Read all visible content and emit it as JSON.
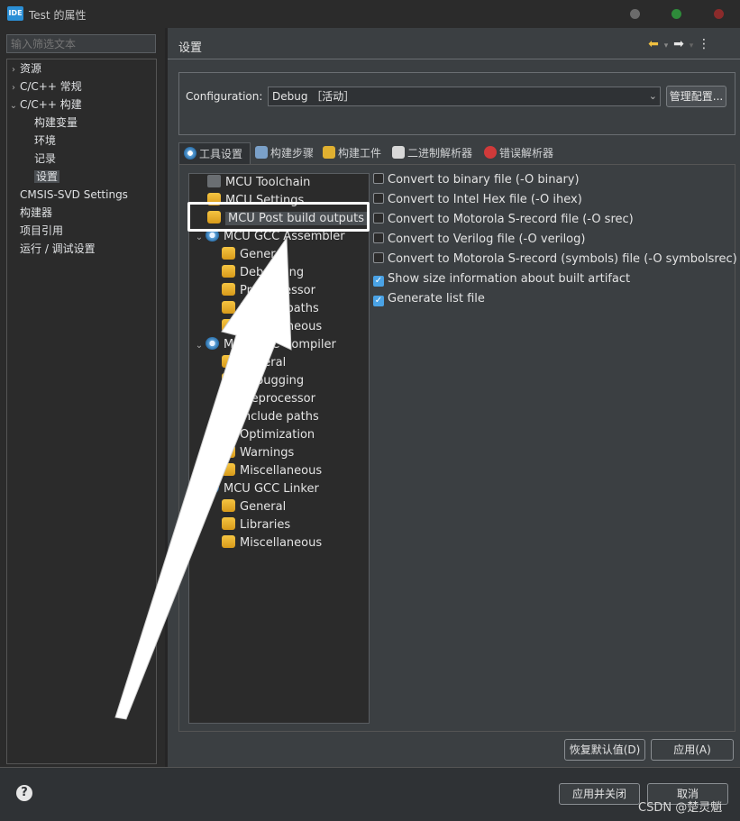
{
  "window": {
    "app_icon_text": "IDE",
    "title": "Test 的属性"
  },
  "sidebar": {
    "filter_placeholder": "输入筛选文本",
    "items": [
      {
        "label": "资源",
        "arrow": "›"
      },
      {
        "label": "C/C++ 常规",
        "arrow": "›"
      },
      {
        "label": "C/C++ 构建",
        "arrow": "⌄"
      },
      {
        "label": "构建变量"
      },
      {
        "label": "环境"
      },
      {
        "label": "记录"
      },
      {
        "label": "设置"
      },
      {
        "label": "CMSIS-SVD Settings"
      },
      {
        "label": "构建器"
      },
      {
        "label": "项目引用"
      },
      {
        "label": "运行 / 调试设置"
      }
    ]
  },
  "header": {
    "section_title": "设置"
  },
  "configuration": {
    "label": "Configuration:",
    "value": "Debug ［活动］",
    "manage_button": "管理配置..."
  },
  "tabs": [
    {
      "label": "工具设置",
      "active": true
    },
    {
      "label": "构建步骤"
    },
    {
      "label": "构建工件"
    },
    {
      "label": "二进制解析器"
    },
    {
      "label": "错误解析器"
    }
  ],
  "tool_tree": [
    {
      "label": "MCU Toolchain"
    },
    {
      "label": "MCU Settings"
    },
    {
      "label": "MCU Post build outputs"
    },
    {
      "label": "MCU GCC Assembler"
    },
    {
      "label": "General"
    },
    {
      "label": "Debugging"
    },
    {
      "label": "Preprocessor"
    },
    {
      "label": "Include paths"
    },
    {
      "label": "Miscellaneous"
    },
    {
      "label": "MCU GCC Compiler"
    },
    {
      "label": "General"
    },
    {
      "label": "Debugging"
    },
    {
      "label": "Preprocessor"
    },
    {
      "label": "Include paths"
    },
    {
      "label": "Optimization"
    },
    {
      "label": "Warnings"
    },
    {
      "label": "Miscellaneous"
    },
    {
      "label": "MCU GCC Linker"
    },
    {
      "label": "General"
    },
    {
      "label": "Libraries"
    },
    {
      "label": "Miscellaneous"
    }
  ],
  "options": [
    {
      "label": "Convert to binary file (-O binary)",
      "checked": false
    },
    {
      "label": "Convert to Intel Hex file (-O ihex)",
      "checked": false
    },
    {
      "label": "Convert to Motorola S-record file (-O srec)",
      "checked": false
    },
    {
      "label": "Convert to Verilog file (-O verilog)",
      "checked": false
    },
    {
      "label": "Convert to Motorola S-record (symbols) file (-O symbolsrec)",
      "checked": false
    },
    {
      "label": "Show size information about built artifact",
      "checked": true
    },
    {
      "label": "Generate list file",
      "checked": true
    }
  ],
  "buttons": {
    "restore_defaults": "恢复默认值(D)",
    "apply": "应用(A)",
    "apply_and_close": "应用并关闭",
    "cancel": "取消"
  },
  "help_icon_text": "?",
  "watermark": "CSDN @楚灵魈",
  "colors": {
    "accent": "#4aa3e6",
    "background": "#3b3f42",
    "panel": "#2b2b2b"
  }
}
